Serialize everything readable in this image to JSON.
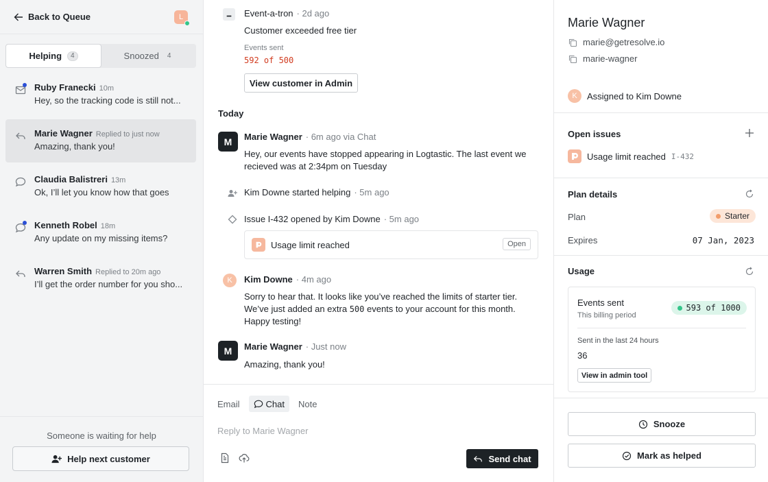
{
  "sidebar": {
    "back_label": "Back to Queue",
    "me_initial": "L",
    "tabs": [
      {
        "label": "Helping",
        "count": "4"
      },
      {
        "label": "Snoozed",
        "count": "4"
      }
    ],
    "conversations": [
      {
        "name": "Ruby Franecki",
        "time": "10m",
        "preview": "Hey, so the tracking code is still not...",
        "icon": "mail-icon",
        "unread": true
      },
      {
        "name": "Marie Wagner",
        "time": "Replied to just now",
        "preview": "Amazing, thank you!",
        "icon": "reply-icon",
        "unread": false
      },
      {
        "name": "Claudia Balistreri",
        "time": "13m",
        "preview": "Ok, I’ll let you know how that goes",
        "icon": "chat-bubble-icon",
        "unread": false
      },
      {
        "name": "Kenneth Robel",
        "time": "18m",
        "preview": "Any update on my missing items?",
        "icon": "chat-bubble-icon",
        "unread": true
      },
      {
        "name": "Warren Smith",
        "time": "Replied to 20m ago",
        "preview": "I’ll get the order number for you sho...",
        "icon": "reply-icon",
        "unread": false
      }
    ],
    "waiting_text": "Someone is waiting for help",
    "help_next_label": "Help next customer"
  },
  "thread": {
    "bot_event": {
      "name": "Event-a-tron",
      "meta": "· 2d ago",
      "text": "Customer exceeded free tier",
      "stat_label": "Events sent",
      "stat_value": "592 of 500",
      "button": "View customer in Admin"
    },
    "day_label": "Today",
    "msg1": {
      "initial": "M",
      "name": "Marie Wagner",
      "meta": "· 6m ago via Chat",
      "line1": "Hey, our events have stopped appearing in Logtastic. The last event we",
      "line2": "recieved was at 2:34pm on Tuesday"
    },
    "sys1": {
      "text": "Kim Downe started helping",
      "meta": "· 5m ago"
    },
    "sys2": {
      "text": "Issue I-432 opened by Kim Downe",
      "meta": "· 5m ago"
    },
    "issue_card": {
      "title": "Usage limit reached",
      "status": "Open"
    },
    "msg2": {
      "initial": "K",
      "name": "Kim Downe",
      "meta": "· 4m ago",
      "line1": "Sorry to hear that. It looks like you’ve reached the limits of starter tier.",
      "line2_pre": "We’ve just added an extra ",
      "line2_mono": "500",
      "line2_post": " events to your account for this month.",
      "line3": "Happy testing!"
    },
    "msg3": {
      "initial": "M",
      "name": "Marie Wagner",
      "meta": "· Just now",
      "text": "Amazing, thank you!"
    }
  },
  "composer": {
    "tabs": [
      "Email",
      "Chat",
      "Note"
    ],
    "active_tab": "Chat",
    "placeholder": "Reply to Marie Wagner",
    "send_label": "Send chat"
  },
  "customer": {
    "name": "Marie Wagner",
    "email": "marie@getresolve.io",
    "username": "marie-wagner",
    "assigned_initial": "K",
    "assigned": "Assigned to Kim Downe",
    "open_issues_title": "Open issues",
    "issue": {
      "title": "Usage limit reached",
      "id": "I-432"
    },
    "plan_title": "Plan details",
    "plan_label": "Plan",
    "plan_value": "Starter",
    "expires_label": "Expires",
    "expires_value": "07 Jan, 2023",
    "usage_title": "Usage",
    "usage": {
      "label": "Events sent",
      "sub": "This billing period",
      "value": "593 of 1000",
      "last24_label": "Sent in the last 24 hours",
      "last24_value": "36",
      "admin_button": "View in admin tool"
    },
    "snooze_label": "Snooze",
    "helped_label": "Mark as helped"
  },
  "colors": {
    "accent_dark": "#1d2226",
    "alert_red": "#d13b1f",
    "starter_pill": "#fde6d8",
    "usage_pill": "#dcf5ea",
    "unread_dot": "#2b4fd6"
  }
}
